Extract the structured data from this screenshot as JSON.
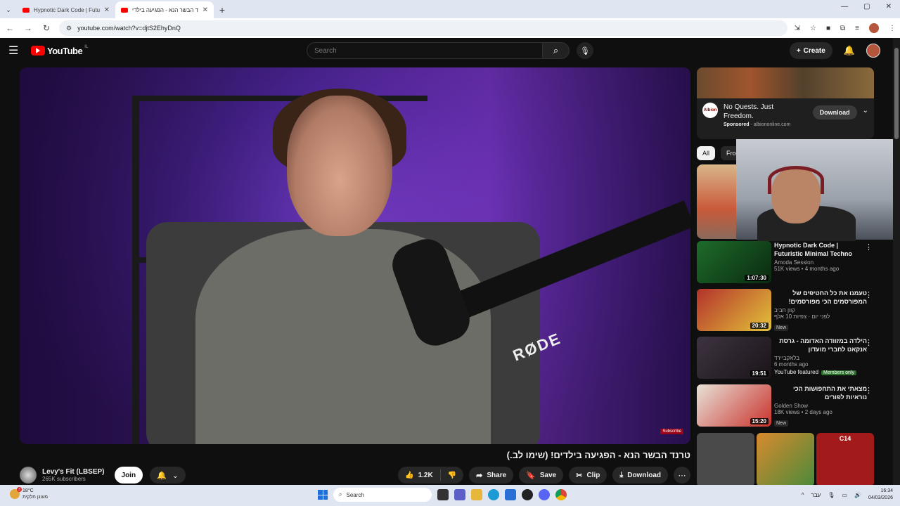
{
  "browser": {
    "tabs": [
      {
        "title": "Hypnotic Dark Code | Futuristic",
        "active": false
      },
      {
        "title": "טרנד הבשר הנא - הפגיעה בילדי",
        "active": true
      }
    ],
    "url": "youtube.com/watch?v=djtS2EhyDnQ"
  },
  "header": {
    "logo": "YouTube",
    "region": "IL",
    "search_placeholder": "Search",
    "create_label": "Create"
  },
  "video": {
    "watermark": "Subscribe",
    "mic_brand": "RØDE",
    "title": "טרנד הבשר הנא - הפגיעה בילדים! (שימו לב.)",
    "channel": "Levy's Fit (LBSEP)",
    "subscribers": "265K subscribers",
    "join_label": "Join",
    "likes": "1.2K",
    "share_label": "Share",
    "save_label": "Save",
    "clip_label": "Clip",
    "download_label": "Download"
  },
  "ad": {
    "logo_text": "Albion",
    "title": "No Quests. Just Freedom.",
    "sponsored": "Sponsored",
    "domain": "albiononline.com",
    "cta": "Download"
  },
  "chips": [
    "All",
    "From"
  ],
  "recommendations": [
    {
      "title": "Hypnotic Dark Code | Futuristic Minimal Techno Vibes",
      "channel": "Amoda Session",
      "meta": "51K views • 4 months ago",
      "duration": "1:07:30",
      "rtl": false,
      "badge": "",
      "thumb": "#1e6b2a"
    },
    {
      "title": "טעמנו את כל החטיפים של המפורסמים הכי מפורסמים!(חיקוי מול אמיתי)",
      "channel": "קוון חביב",
      "meta": "לפני יום · צפיות 10 אלף",
      "duration": "20:32",
      "rtl": true,
      "badge": "New",
      "thumb": "#b3322b"
    },
    {
      "title": "הילדה במזוודה האדומה - גרסת אנקאט לחברי מועדון",
      "channel": "בלאקביירד",
      "meta": "6 months ago",
      "duration": "19:51",
      "rtl": true,
      "badge": "",
      "featured": "YouTube featured",
      "members": "Members only",
      "thumb": "#3d3340"
    },
    {
      "title": "מצאתי את התחפושות הכי נוראיות לפורים",
      "channel": "Golden Show",
      "meta": "18K views • 2 days ago",
      "duration": "15:20",
      "rtl": true,
      "badge": "New",
      "thumb": "#c9c0b0"
    }
  ],
  "shorts": [
    {
      "color": "#4a4a4a"
    },
    {
      "color": "#d98a2e"
    },
    {
      "color": "#a31a1a",
      "label": "C14"
    }
  ],
  "taskbar": {
    "temp": "18°C",
    "weather_desc": "מעונן חלקית",
    "weather_badge": "3",
    "search": "Search",
    "lang": "עבר",
    "time": "16:34",
    "date": "04/03/2026"
  }
}
